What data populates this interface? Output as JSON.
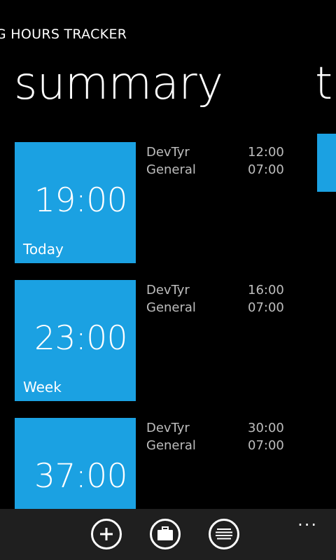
{
  "app": {
    "title": "IG HOURS TRACKER"
  },
  "pivot": {
    "current": "summary",
    "next_peek": "t"
  },
  "summary": [
    {
      "label": "Today",
      "total": "19:00",
      "items": [
        {
          "name": "DevTyr",
          "hours": "12:00"
        },
        {
          "name": "General",
          "hours": "07:00"
        }
      ]
    },
    {
      "label": "Week",
      "total": "23:00",
      "items": [
        {
          "name": "DevTyr",
          "hours": "16:00"
        },
        {
          "name": "General",
          "hours": "07:00"
        }
      ]
    },
    {
      "label": "",
      "total": "37:00",
      "items": [
        {
          "name": "DevTyr",
          "hours": "30:00"
        },
        {
          "name": "General",
          "hours": "07:00"
        }
      ]
    }
  ],
  "appbar": {
    "buttons": [
      {
        "icon": "add-icon"
      },
      {
        "icon": "briefcase-icon"
      },
      {
        "icon": "list-icon"
      }
    ],
    "more": "..."
  },
  "colors": {
    "accent": "#1ba1e2",
    "background": "#000000",
    "appbar": "#1f1f1f"
  }
}
